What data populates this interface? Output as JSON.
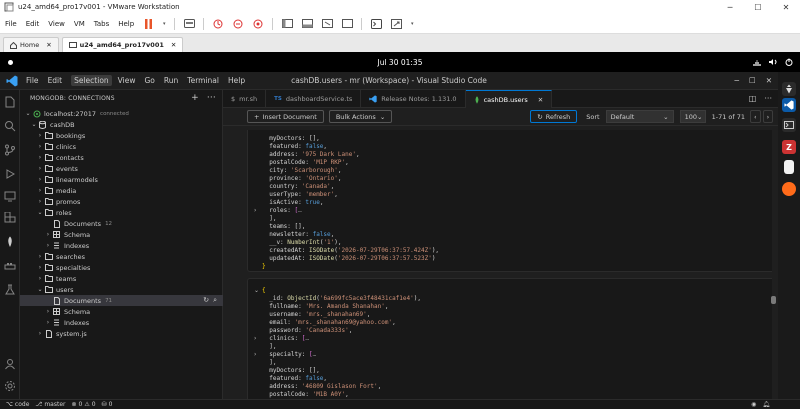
{
  "vmware": {
    "title": "u24_amd64_pro17v001 - VMware Workstation",
    "menus": [
      "File",
      "Edit",
      "View",
      "VM",
      "Tabs",
      "Help"
    ],
    "tabs": [
      {
        "label": "Home"
      },
      {
        "label": "u24_amd64_pro17v001"
      }
    ]
  },
  "ubuntu": {
    "clock": "Jul 30  01:35"
  },
  "vscode": {
    "menus": [
      "File",
      "Edit",
      "Selection",
      "View",
      "Go",
      "Run",
      "Terminal",
      "Help"
    ],
    "window_title": "cashDB.users - mr (Workspace) - Visual Studio Code"
  },
  "sidebar": {
    "title": "MONGODB: CONNECTIONS",
    "connection": {
      "name": "localhost:27017",
      "status": "connected"
    },
    "database": "cashDB",
    "collections": [
      "bookings",
      "clinics",
      "contacts",
      "events",
      "linearmodels",
      "media",
      "promos",
      "roles",
      "searches",
      "specialties",
      "teams",
      "users",
      "system.js"
    ],
    "roles_children": [
      {
        "label": "Documents",
        "count": "12"
      },
      {
        "label": "Schema"
      },
      {
        "label": "Indexes"
      }
    ],
    "users_children": [
      {
        "label": "Documents",
        "count": "71"
      },
      {
        "label": "Schema"
      },
      {
        "label": "Indexes"
      }
    ]
  },
  "editor": {
    "tabs": [
      {
        "label": "mr.sh"
      },
      {
        "label": "dashboardService.ts"
      },
      {
        "label": "Release Notes: 1.131.0"
      },
      {
        "label": "cashDB.users"
      }
    ],
    "toolbar": {
      "insert_label": "Insert Document",
      "bulk_label": "Bulk Actions",
      "refresh_label": "Refresh",
      "sort_label": "Sort",
      "sort_value": "Default",
      "page_size": "100",
      "range": "1-71 of 71"
    },
    "doc1_lines": [
      "  myDoctors: [],",
      "  featured: false,",
      "  address: '975 Dark Lane',",
      "  postalCode: 'M1P RKP',",
      "  city: 'Scarborough',",
      "  province: 'Ontario',",
      "  country: 'Canada',",
      "  userType: 'member',",
      "  isActive: true,",
      "  roles: [→",
      "  ],",
      "  teams: [],",
      "  newsletter: false,",
      "  __v: NumberInt('1'),",
      "  createdAt: ISODate('2026-07-29T06:37:57.424Z'),",
      "  updatedAt: ISODate('2026-07-29T06:37:57.523Z')",
      "}"
    ],
    "doc2_lines": [
      "{",
      "  _id: ObjectId('6a699fc5ace3f48431caf1e4'),",
      "  fullname: 'Mrs. Amanda Shanahan',",
      "  username: 'mrs._shanahan69',",
      "  email: 'mrs._shanahan69@yahoo.com',",
      "  password: 'Canada333s',",
      "  clinics: [→",
      "  ],",
      "  specialty: [→",
      "  ],",
      "  myDoctors: [],",
      "  featured: false,",
      "  address: '46809 Gislason Fort',",
      "  postalCode: 'M1B A0Y',",
      "  city: 'Scarborough',"
    ]
  },
  "statusbar": {
    "items": [
      "code",
      "master",
      "0",
      "0",
      "0"
    ]
  },
  "colors": {
    "accent": "#0078d4",
    "string": "#ce9178",
    "keyword": "#569cd6"
  }
}
